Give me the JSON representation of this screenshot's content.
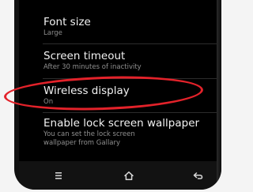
{
  "settings": {
    "items": [
      {
        "title": "Font size",
        "subtitle": "Large"
      },
      {
        "title": "Screen timeout",
        "subtitle": "After 30 minutes of inactivity"
      },
      {
        "title": "Wireless display",
        "subtitle": "On"
      },
      {
        "title": "Enable lock screen wallpaper",
        "subtitle": "You can set the lock screen",
        "subtitle2": "wallpaper from Gallary"
      }
    ]
  },
  "annotation": {
    "highlight_color": "#e3222a",
    "highlighted_item": "Wireless display"
  },
  "navbar": {
    "icons": [
      "menu-icon",
      "home-icon",
      "back-icon"
    ]
  }
}
